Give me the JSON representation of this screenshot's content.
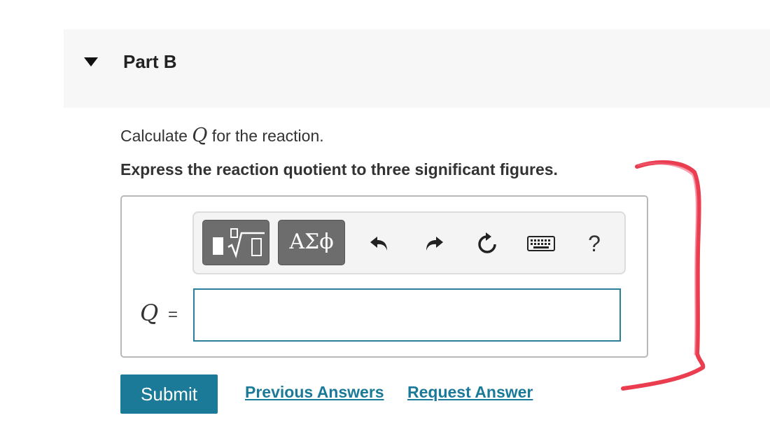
{
  "part": {
    "title": "Part B"
  },
  "question": {
    "prefix": "Calculate ",
    "variable": "Q",
    "suffix": " for the reaction.",
    "instruction": "Express the reaction quotient to three significant figures."
  },
  "toolbar": {
    "templates_icon": "templates-radical-icon",
    "symbols_label": "ΑΣϕ",
    "undo_icon": "undo-icon",
    "redo_icon": "redo-icon",
    "reset_icon": "reset-icon",
    "keyboard_icon": "keyboard-icon",
    "help_label": "?"
  },
  "answer": {
    "variable": "Q",
    "equals": "=",
    "value": "",
    "placeholder": ""
  },
  "actions": {
    "submit_label": "Submit",
    "previous_answers_label": "Previous Answers",
    "request_answer_label": "Request Answer"
  },
  "colors": {
    "accent": "#1c7a99",
    "header_bg": "#f7f7f7",
    "button_gray": "#6d6d6d",
    "annotation_red": "#e8283c"
  }
}
